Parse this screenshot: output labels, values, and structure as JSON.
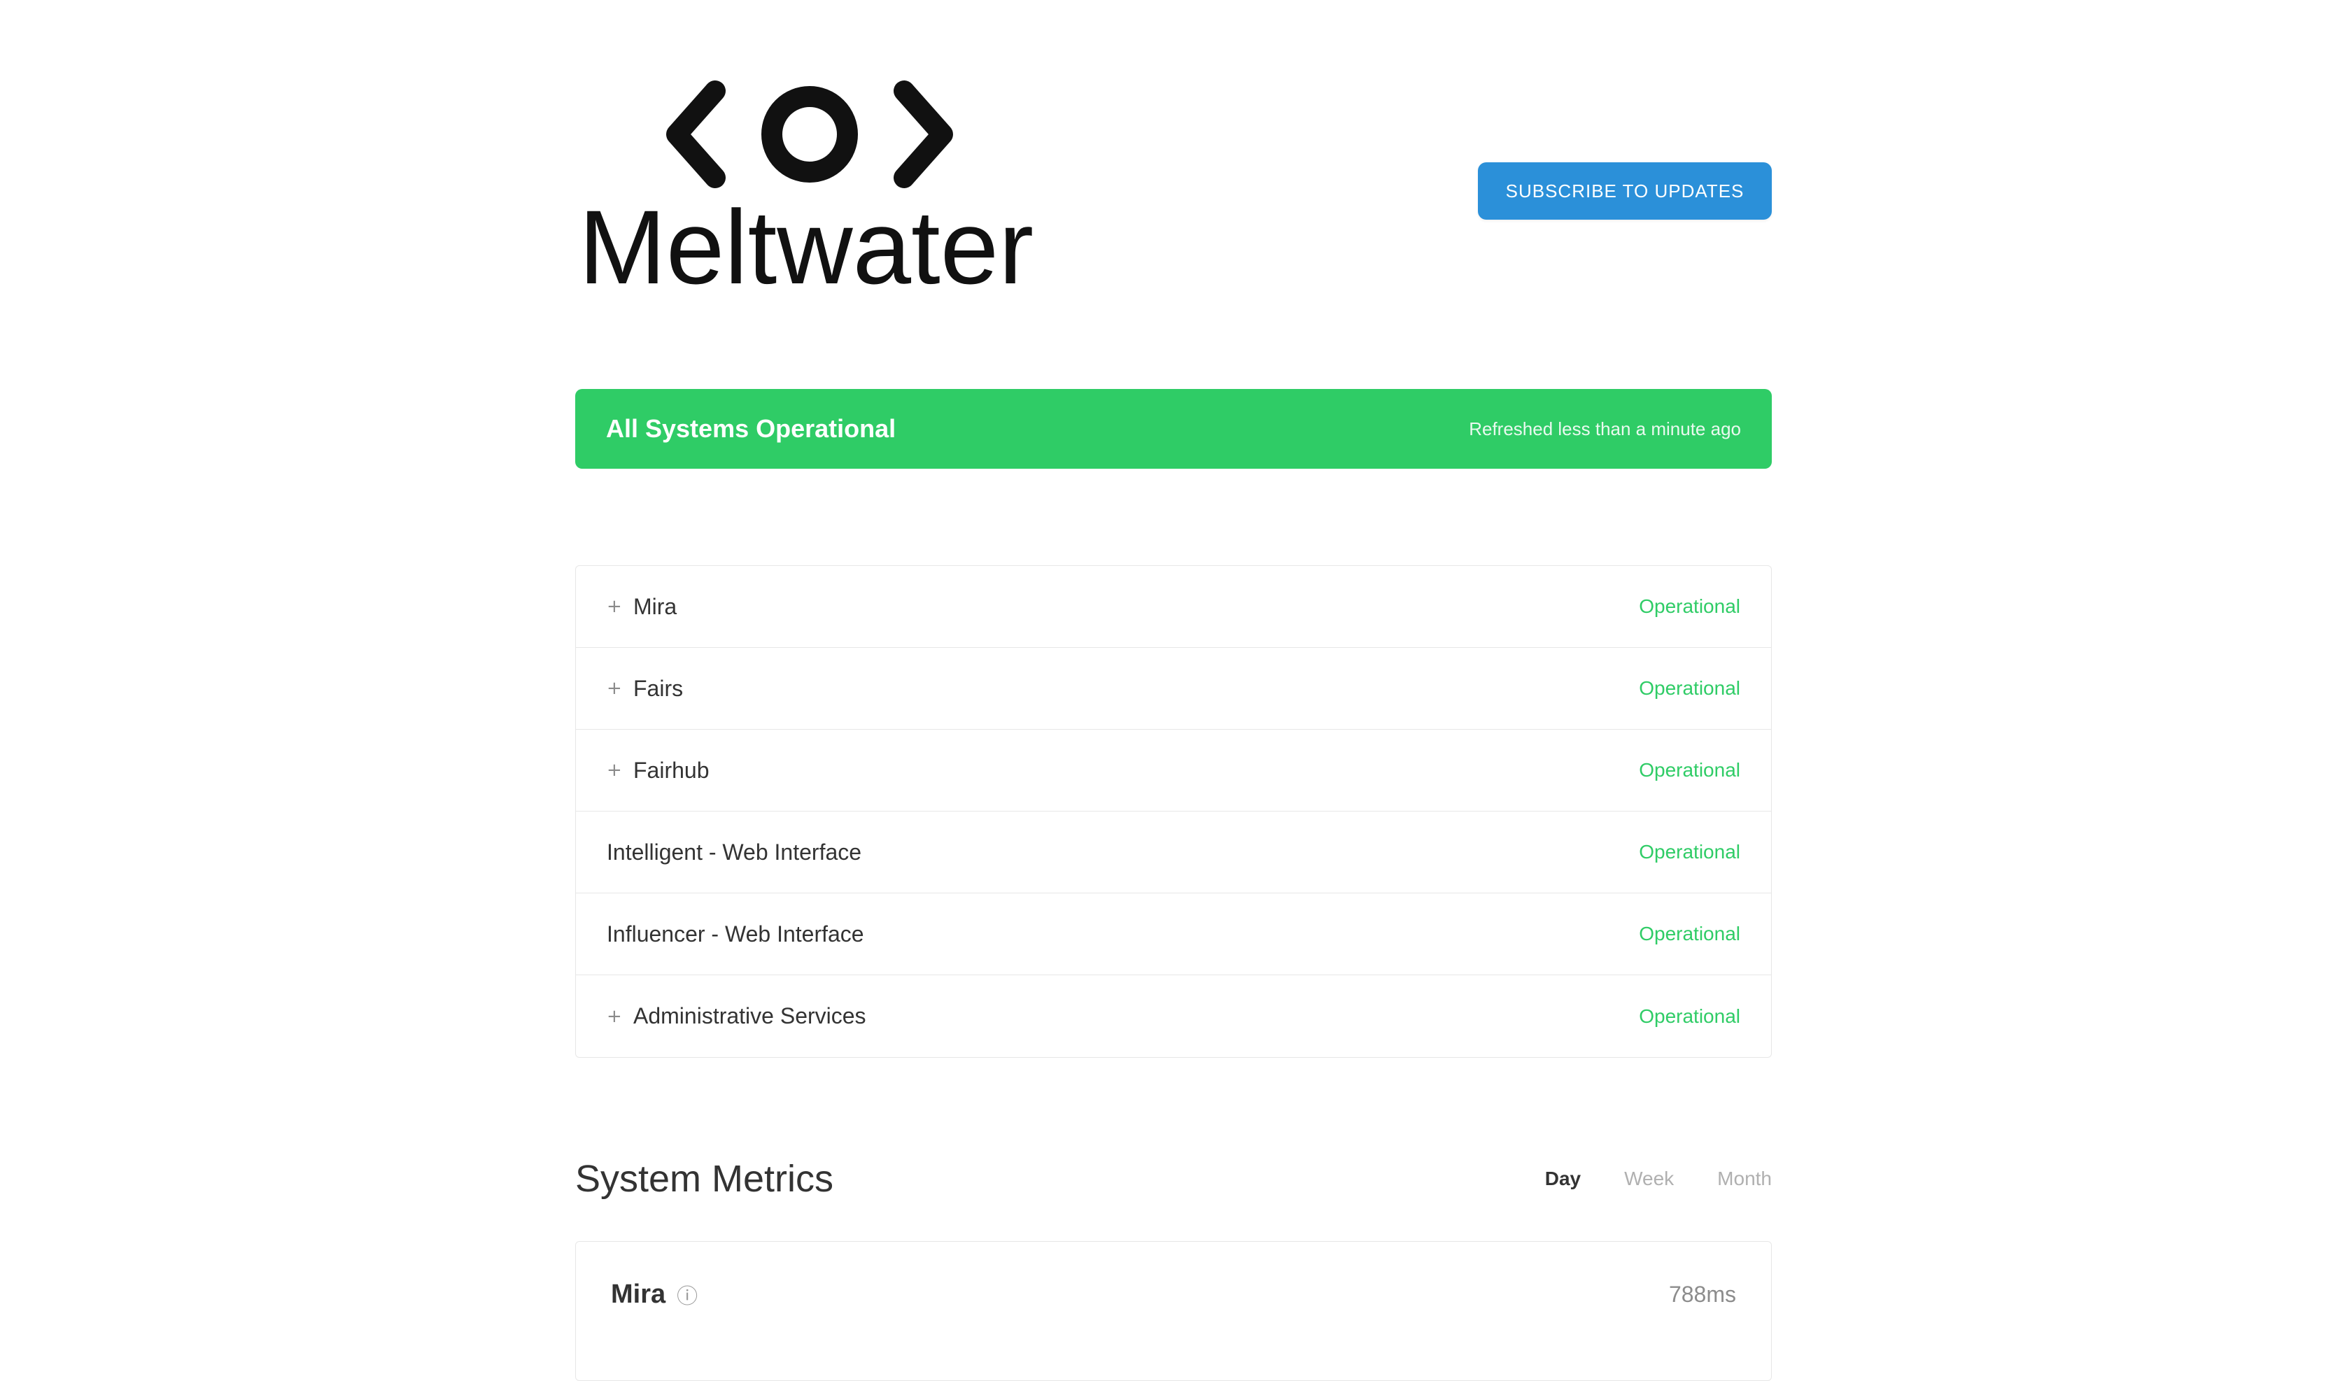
{
  "brand": {
    "logo_text": "Meltwater"
  },
  "header": {
    "subscribe_label": "SUBSCRIBE TO UPDATES"
  },
  "status_banner": {
    "title": "All Systems Operational",
    "refresh_text": "Refreshed less than a minute ago",
    "color": "#2fcc66"
  },
  "components": [
    {
      "name": "Mira",
      "status": "Operational",
      "expandable": true,
      "expand_icon": "plus-icon"
    },
    {
      "name": "Fairs",
      "status": "Operational",
      "expandable": true,
      "expand_icon": "plus-icon"
    },
    {
      "name": "Fairhub",
      "status": "Operational",
      "expandable": true,
      "expand_icon": "plus-icon"
    },
    {
      "name": "Intelligent - Web Interface",
      "status": "Operational",
      "expandable": false
    },
    {
      "name": "Influencer - Web Interface",
      "status": "Operational",
      "expandable": false
    },
    {
      "name": "Administrative Services",
      "status": "Operational",
      "expandable": true,
      "expand_icon": "plus-icon"
    }
  ],
  "metrics": {
    "title": "System Metrics",
    "ranges": [
      "Day",
      "Week",
      "Month"
    ],
    "active_range": "Day",
    "cards": [
      {
        "name": "Mira",
        "info_icon": "info-icon",
        "value": "788ms"
      }
    ]
  },
  "colors": {
    "accent_blue": "#2b90d9",
    "operational_green": "#2fcc66"
  }
}
